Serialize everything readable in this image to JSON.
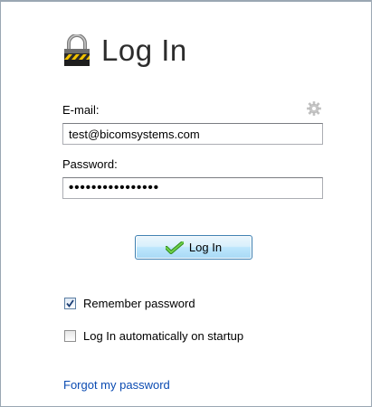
{
  "header": {
    "title": "Log In",
    "icon": "lock-icon"
  },
  "form": {
    "email_label": "E-mail:",
    "email_value": "test@bicomsystems.com",
    "password_label": "Password:",
    "password_value": "••••••••••••••••",
    "settings_icon": "gear-icon"
  },
  "actions": {
    "login_label": "Log In",
    "login_icon": "checkmark-icon"
  },
  "options": {
    "remember_label": "Remember password",
    "remember_checked": true,
    "autologin_label": "Log In automatically on startup",
    "autologin_checked": false
  },
  "links": {
    "forgot_label": "Forgot my password"
  },
  "colors": {
    "link": "#0b4bb2",
    "button_border": "#3c7fb1",
    "check_green": "#4caf2e",
    "lock_yellow": "#f2c200"
  }
}
